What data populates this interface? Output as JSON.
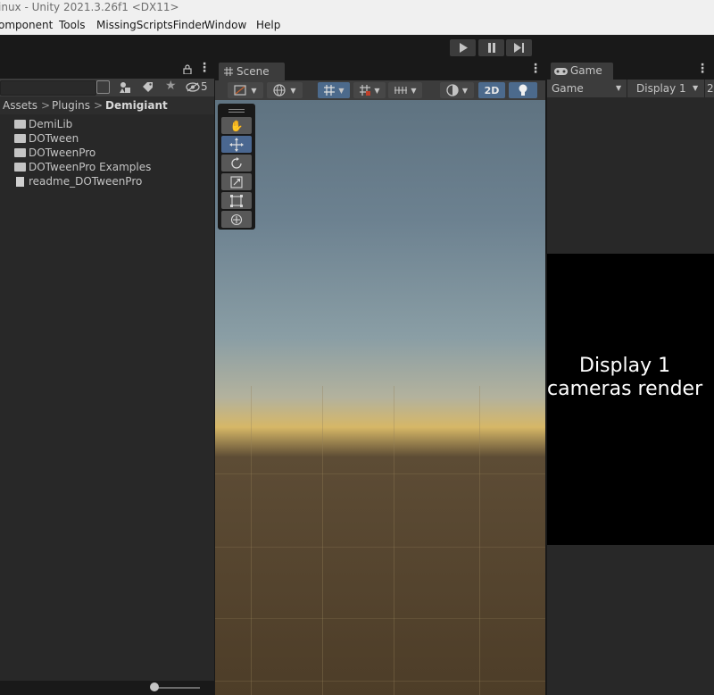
{
  "window": {
    "title": "inux - Unity 2021.3.26f1 <DX11>"
  },
  "menu": [
    "omponent",
    "Tools",
    "MissingScriptsFinder",
    "Window",
    "Help"
  ],
  "playbar": {
    "play": "▶",
    "pause": "❚❚",
    "step": "▶❘"
  },
  "project": {
    "hidden_count": "5",
    "breadcrumb": [
      "Assets",
      "Plugins",
      "Demigiant"
    ],
    "breadcrumb_sep": ">",
    "items": [
      {
        "label": "DemiLib",
        "type": "folder"
      },
      {
        "label": "DOTween",
        "type": "folder"
      },
      {
        "label": "DOTweenPro",
        "type": "folder"
      },
      {
        "label": "DOTweenPro Examples",
        "type": "folder"
      },
      {
        "label": "readme_DOTweenPro",
        "type": "file"
      }
    ]
  },
  "scene": {
    "tab_label": "Scene",
    "toolbar": {
      "mode_2d": "2D"
    }
  },
  "game": {
    "tab_label": "Game",
    "view_select": "Game",
    "display_select": "Display 1",
    "next_select": "2",
    "message_line1": "Display 1",
    "message_line2": "cameras render"
  },
  "colors": {
    "accent_blue": "#4c6a8c",
    "selected_tool": "#4a6790",
    "panel_bg": "#282828",
    "menu_bg": "#f0f0f0"
  }
}
